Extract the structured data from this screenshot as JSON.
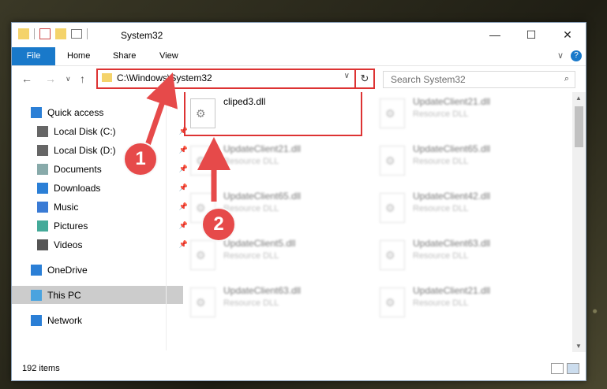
{
  "window": {
    "title": "System32",
    "controls": {
      "minimize": "—",
      "maximize": "☐",
      "close": "✕"
    }
  },
  "ribbon": {
    "tabs": [
      "File",
      "Home",
      "Share",
      "View"
    ],
    "chevron": "∨",
    "help": "?"
  },
  "address": {
    "path": "C:\\Windows\\System32",
    "dropdown": "∨",
    "refresh": "↻"
  },
  "search": {
    "placeholder": "Search System32"
  },
  "nav": {
    "items": [
      {
        "label": "Quick access",
        "icon": "star-icon"
      },
      {
        "label": "Local Disk (C:)",
        "icon": "drive-icon",
        "pinned": true
      },
      {
        "label": "Local Disk (D:)",
        "icon": "drive-icon",
        "pinned": true
      },
      {
        "label": "Documents",
        "icon": "documents-icon",
        "pinned": true
      },
      {
        "label": "Downloads",
        "icon": "downloads-icon",
        "pinned": true
      },
      {
        "label": "Music",
        "icon": "music-icon",
        "pinned": true
      },
      {
        "label": "Pictures",
        "icon": "pictures-icon",
        "pinned": true
      },
      {
        "label": "Videos",
        "icon": "videos-icon",
        "pinned": true
      },
      {
        "label": "OneDrive",
        "icon": "cloud-icon"
      },
      {
        "label": "This PC",
        "icon": "pc-icon",
        "selected": true
      },
      {
        "label": "Network",
        "icon": "network-icon"
      }
    ]
  },
  "files": [
    {
      "name": "cliped3.dll",
      "type": ""
    },
    {
      "name": "UpdateClient21.dll",
      "type": "Resource DLL"
    },
    {
      "name": "UpdateClient21.dll",
      "type": "Resource DLL"
    },
    {
      "name": "UpdateClient65.dll",
      "type": "Resource DLL"
    },
    {
      "name": "UpdateClient65.dll",
      "type": "Resource DLL"
    },
    {
      "name": "UpdateClient42.dll",
      "type": "Resource DLL"
    },
    {
      "name": "UpdateClient5.dll",
      "type": "Resource DLL"
    },
    {
      "name": "UpdateClient63.dll",
      "type": "Resource DLL"
    },
    {
      "name": "UpdateClient63.dll",
      "type": "Resource DLL"
    },
    {
      "name": "UpdateClient21.dll",
      "type": "Resource DLL"
    }
  ],
  "status": {
    "count": "192 items"
  },
  "callouts": [
    "1",
    "2"
  ],
  "colors": {
    "accent": "#1979ca",
    "highlight": "#dd3333",
    "callout": "#e64a4a"
  }
}
